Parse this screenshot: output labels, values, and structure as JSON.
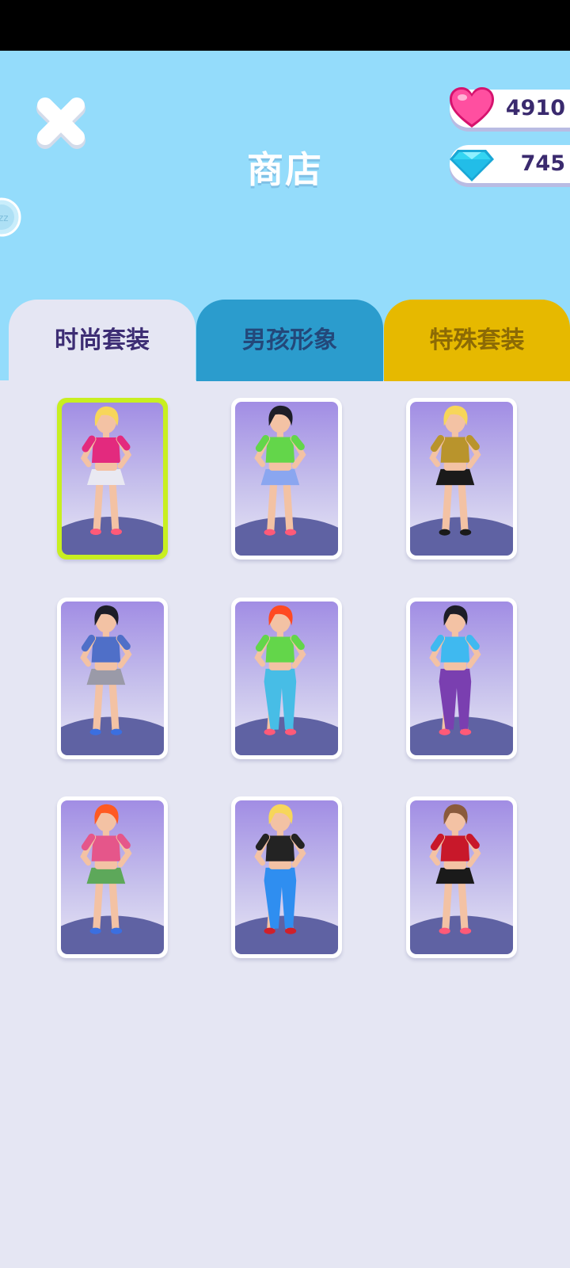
{
  "header": {
    "title": "商店"
  },
  "currency": {
    "hearts": {
      "icon": "heart-icon",
      "value": "4910",
      "color": "#ff4fa0"
    },
    "gems": {
      "icon": "diamond-icon",
      "value": "745",
      "color": "#34d5f2"
    }
  },
  "tabs": [
    {
      "label": "时尚套装",
      "active": true
    },
    {
      "label": "男孩形象",
      "active": false
    },
    {
      "label": "特殊套装",
      "active": false
    }
  ],
  "outfits": [
    {
      "selected": true,
      "hair": "#f7d65a",
      "top": "#e32a7e",
      "bottom": "#e9e9f2",
      "shoes": "#ff5a78",
      "long": false
    },
    {
      "selected": false,
      "hair": "#1d1d27",
      "top": "#63d64a",
      "bottom": "#8aa6f0",
      "shoes": "#ff5a78",
      "long": false
    },
    {
      "selected": false,
      "hair": "#f7d65a",
      "top": "#b9942c",
      "bottom": "#1a1a1a",
      "shoes": "#1a1a1a",
      "long": false
    },
    {
      "selected": false,
      "hair": "#1d1d27",
      "top": "#4f6fc8",
      "bottom": "#9a9aa8",
      "shoes": "#3b6fe0",
      "long": false
    },
    {
      "selected": false,
      "hair": "#ff4a22",
      "top": "#63d64a",
      "bottom": "#47bde6",
      "shoes": "#ff5a78",
      "long": true
    },
    {
      "selected": false,
      "hair": "#1d1d27",
      "top": "#3fb9f0",
      "bottom": "#7a3fb0",
      "shoes": "#ff5a78",
      "long": true
    },
    {
      "selected": false,
      "hair": "#ff5a22",
      "top": "#e5568a",
      "bottom": "#5da85a",
      "shoes": "#3b6fe0",
      "long": false
    },
    {
      "selected": false,
      "hair": "#f7d65a",
      "top": "#232323",
      "bottom": "#2f8ef0",
      "shoes": "#d0202a",
      "long": true
    },
    {
      "selected": false,
      "hair": "#8a5a3c",
      "top": "#c8182a",
      "bottom": "#1a1a1a",
      "shoes": "#ff5a78",
      "long": false
    }
  ]
}
